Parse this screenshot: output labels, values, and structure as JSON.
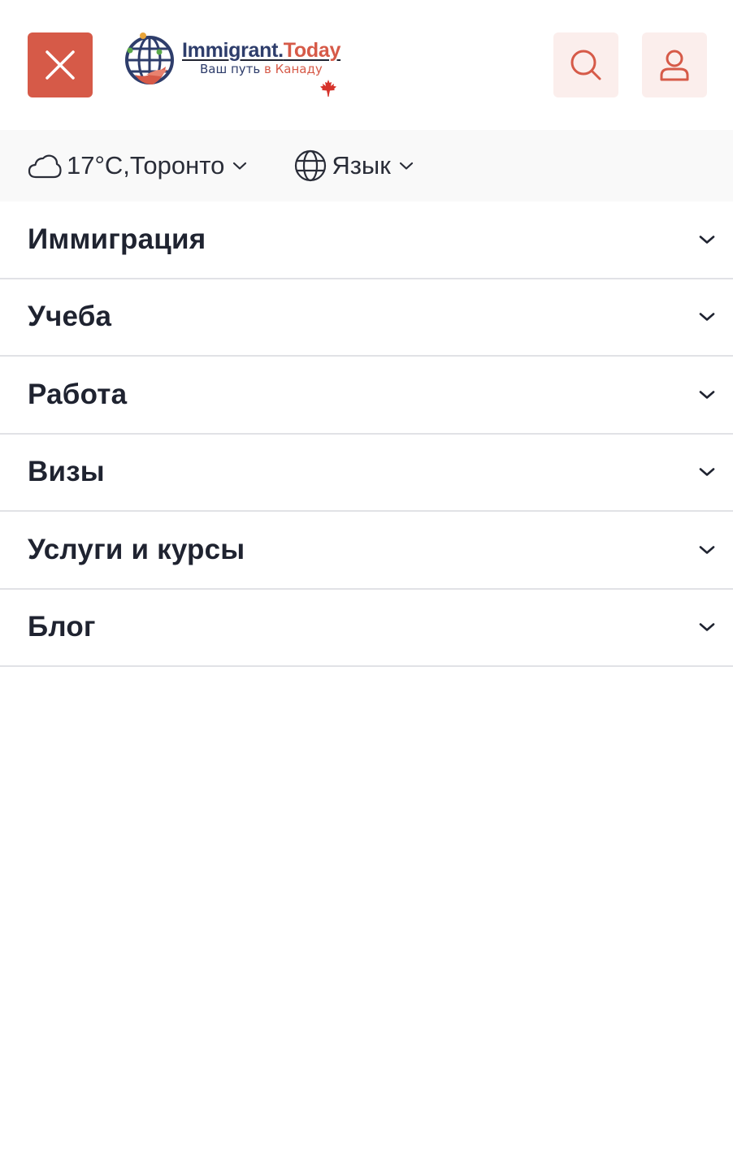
{
  "header": {
    "logo": {
      "title_part1": "Immigrant.",
      "title_part2": "Today",
      "subtitle_part1": "Ваш путь",
      "subtitle_part2": "в Канаду"
    },
    "icons": {
      "close": "close-icon",
      "search": "search-icon",
      "user": "user-icon"
    },
    "colors": {
      "accent": "#d65a48",
      "accent_light": "#fbeeec",
      "brand_navy": "#2e3d6b"
    }
  },
  "infobar": {
    "weather": {
      "icon": "cloud-icon",
      "label": "17°C,Торонто"
    },
    "language": {
      "icon": "globe-icon",
      "label": "Язык"
    }
  },
  "menu": {
    "items": [
      {
        "label": "Иммиграция"
      },
      {
        "label": "Учеба"
      },
      {
        "label": "Работа"
      },
      {
        "label": "Визы"
      },
      {
        "label": "Услуги и курсы"
      },
      {
        "label": "Блог"
      }
    ]
  }
}
